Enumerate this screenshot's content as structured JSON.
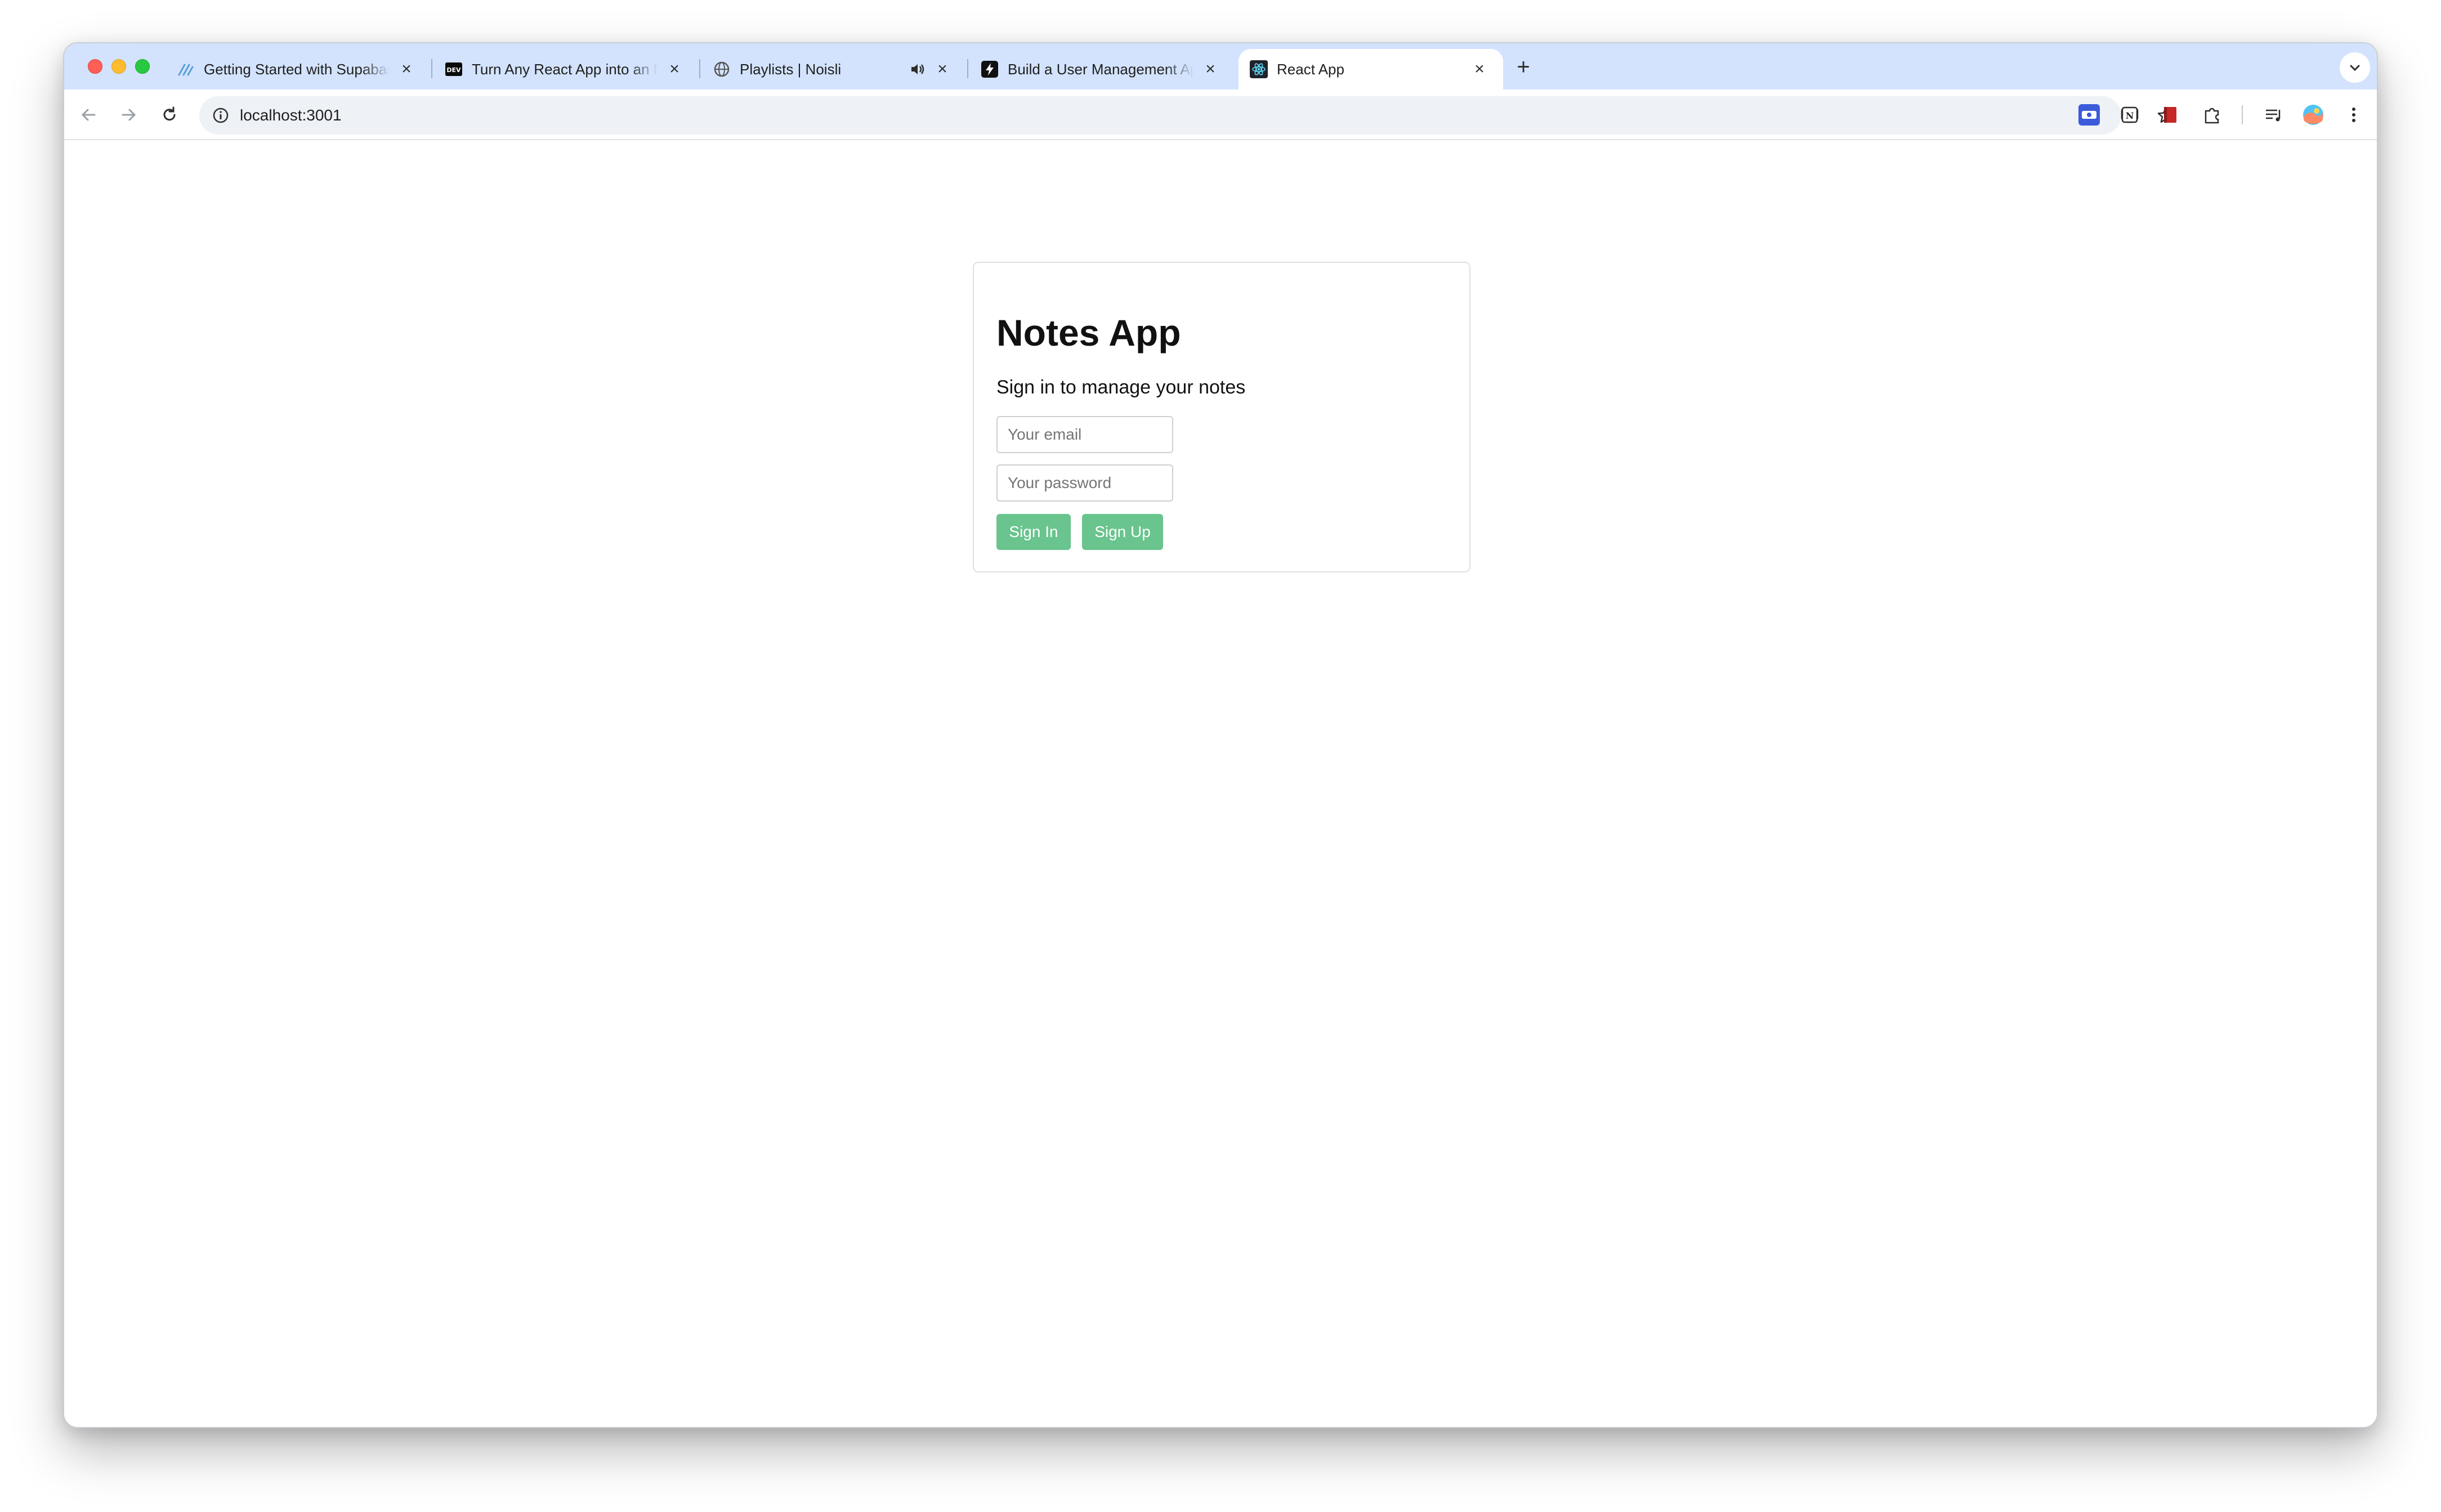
{
  "browser": {
    "tabs": [
      {
        "title": "Getting Started with Supabase",
        "favicon": "supabase-icon",
        "active": false
      },
      {
        "title": "Turn Any React App into an M",
        "favicon": "dev-icon",
        "active": false
      },
      {
        "title": "Playlists | Noisli",
        "favicon": "globe-icon",
        "active": false,
        "audio": true
      },
      {
        "title": "Build a User Management App",
        "favicon": "bolt-icon",
        "active": false
      },
      {
        "title": "React App",
        "favicon": "react-icon",
        "active": true
      }
    ],
    "new_tab_label": "+",
    "url": "localhost:3001",
    "colors": {
      "tabstrip": "#d3e3fd",
      "omnibox": "#eef1f6"
    }
  },
  "app": {
    "title": "Notes App",
    "subtitle": "Sign in to manage your notes",
    "email_placeholder": "Your email",
    "password_placeholder": "Your password",
    "sign_in_label": "Sign In",
    "sign_up_label": "Sign Up",
    "button_color": "#69c48d"
  }
}
